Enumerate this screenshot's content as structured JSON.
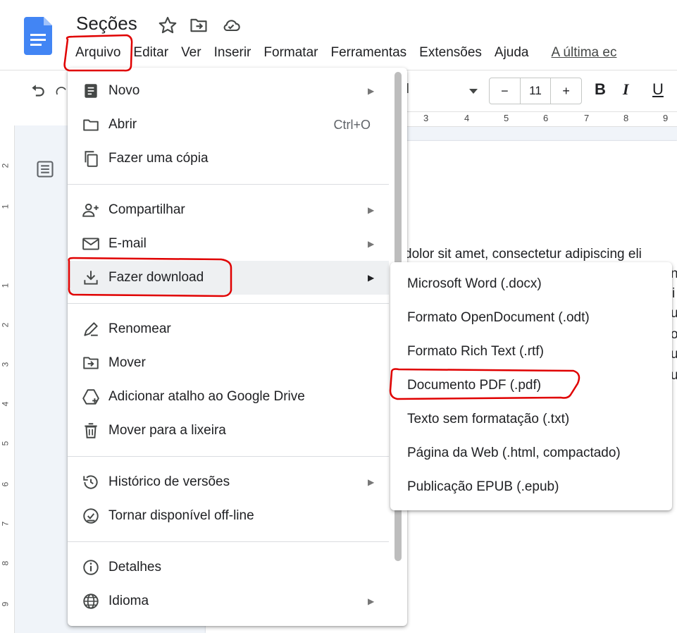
{
  "header": {
    "doc_title": "Seções",
    "menus": [
      "Arquivo",
      "Editar",
      "Ver",
      "Inserir",
      "Formatar",
      "Ferramentas",
      "Extensões",
      "Ajuda"
    ],
    "last_edit": "A última ec"
  },
  "toolbar": {
    "font_fragment": "al",
    "font_size": "11",
    "minus": "−",
    "plus": "+",
    "bold": "B",
    "italic": "I",
    "underline": "U"
  },
  "ruler": [
    "3",
    "4",
    "5",
    "6",
    "7",
    "8",
    "9"
  ],
  "vertical_ruler": [
    "2",
    "1",
    "1",
    "2",
    "3",
    "4",
    "5",
    "6",
    "7",
    "8",
    "9"
  ],
  "document": {
    "visible_text": "dolor sit amet, consectetur adipiscing eli",
    "edge_chars": [
      "n",
      "i",
      "u",
      "o",
      "u",
      "u"
    ]
  },
  "file_menu": {
    "items": [
      {
        "label": "Novo",
        "icon": "document-icon",
        "submenu": true
      },
      {
        "label": "Abrir",
        "icon": "folder-icon",
        "shortcut": "Ctrl+O"
      },
      {
        "label": "Fazer uma cópia",
        "icon": "copy-icon"
      },
      {
        "label": "Compartilhar",
        "icon": "person-add-icon",
        "submenu": true
      },
      {
        "label": "E-mail",
        "icon": "email-icon",
        "submenu": true
      },
      {
        "label": "Fazer download",
        "icon": "download-icon",
        "submenu": true,
        "highlighted": true
      },
      {
        "label": "Renomear",
        "icon": "rename-icon"
      },
      {
        "label": "Mover",
        "icon": "move-folder-icon"
      },
      {
        "label": "Adicionar atalho ao Google Drive",
        "icon": "drive-shortcut-icon"
      },
      {
        "label": "Mover para a lixeira",
        "icon": "trash-icon"
      },
      {
        "label": "Histórico de versões",
        "icon": "history-icon",
        "submenu": true
      },
      {
        "label": "Tornar disponível off-line",
        "icon": "offline-icon"
      },
      {
        "label": "Detalhes",
        "icon": "info-icon"
      },
      {
        "label": "Idioma",
        "icon": "globe-icon",
        "submenu": true
      }
    ]
  },
  "download_submenu": {
    "items": [
      "Microsoft Word (.docx)",
      "Formato OpenDocument (.odt)",
      "Formato Rich Text (.rtf)",
      "Documento PDF (.pdf)",
      "Texto sem formatação (.txt)",
      "Página da Web (.html, compactado)",
      "Publicação EPUB (.epub)"
    ]
  },
  "colors": {
    "docs_blue": "#4285f4",
    "annotation_red": "#e00000",
    "menu_highlight": "#eef0f2"
  }
}
